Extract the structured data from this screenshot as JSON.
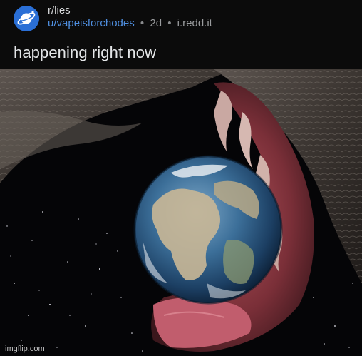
{
  "post": {
    "subreddit": "r/lies",
    "username": "u/vapeisforchodes",
    "separator": "•",
    "age": "2d",
    "domain": "i.redd.it",
    "title": "happening right now"
  },
  "icons": {
    "subreddit_avatar": "planet-icon"
  },
  "colors": {
    "background": "#0b0b0b",
    "username_link": "#4f8fe0",
    "avatar": "#2a6fd6"
  },
  "watermark": "imgflip.com"
}
